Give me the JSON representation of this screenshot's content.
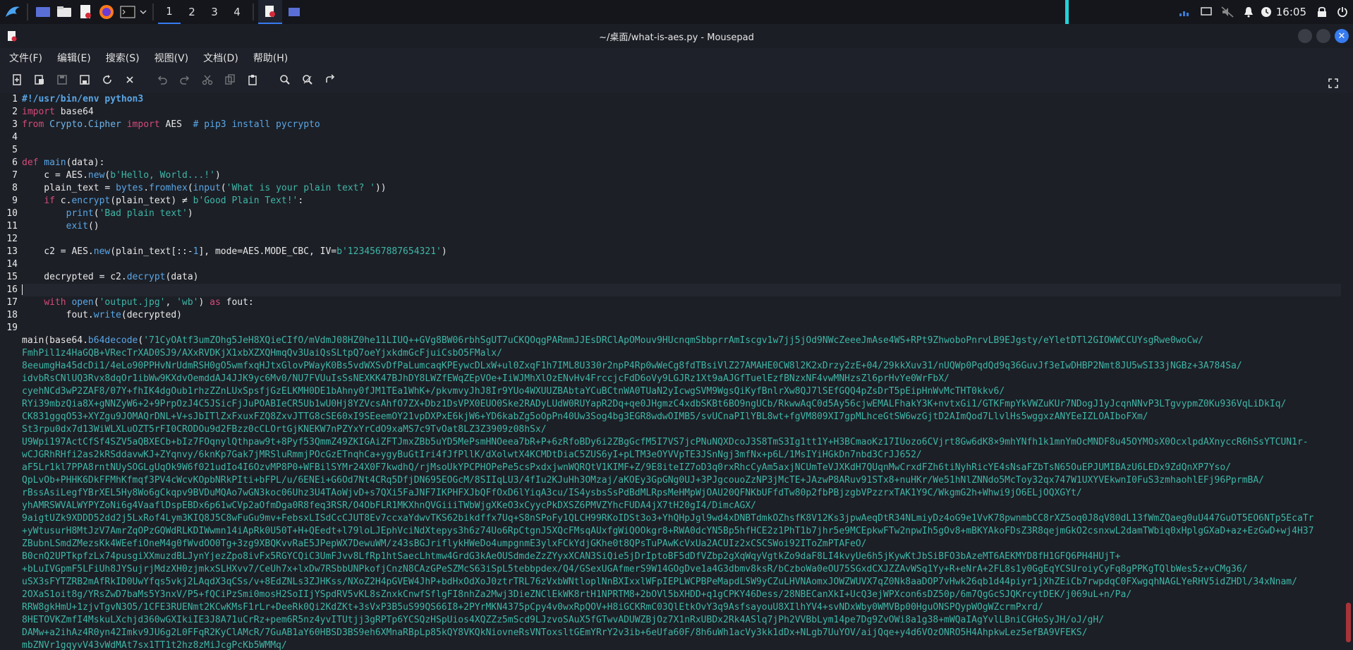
{
  "taskbar": {
    "workspaces": [
      "1",
      "2",
      "3",
      "4"
    ],
    "active_workspace": 0,
    "clock": "16:05",
    "icons": {
      "launcher": "kali-dragon-icon",
      "desktop": "show-desktop-icon",
      "files": "file-manager-icon",
      "editor": "text-editor-icon",
      "browser": "firefox-icon",
      "terminal": "terminal-icon"
    }
  },
  "window": {
    "title": "~/桌面/what-is-aes.py - Mousepad"
  },
  "menu": [
    "文件(F)",
    "编辑(E)",
    "搜索(S)",
    "视图(V)",
    "文档(D)",
    "帮助(H)"
  ],
  "editor": {
    "line_numbers": [
      "1",
      "2",
      "3",
      "4",
      "5",
      "6",
      "7",
      "8",
      "9",
      "10",
      "11",
      "12",
      "13",
      "14",
      "15",
      "16",
      "17",
      "18",
      "19",
      "",
      "",
      "",
      "",
      "",
      "",
      "",
      "",
      "",
      "",
      "",
      "",
      "",
      "",
      "",
      "",
      "",
      "",
      "",
      "",
      "",
      "",
      "",
      "",
      "",
      "",
      ""
    ],
    "code": {
      "l1": "#!/usr/bin/env python3",
      "l2_kw": "import",
      "l2_rest": " base64",
      "l3_kw1": "from",
      "l3_mod": " Crypto.Cipher",
      "l3_kw2": " import",
      "l3_rest": " AES  ",
      "l3_comment": "# pip3 install pycrypto",
      "l6_kw": "def",
      "l6_fn": " main",
      "l6_rest": "(data):",
      "l7_a": "    c = AES.",
      "l7_fn": "new",
      "l7_b": "(",
      "l7_str": "b'Hello, World...!'",
      "l7_c": ")",
      "l8_a": "    plain_text = ",
      "l8_fn1": "bytes",
      "l8_b": ".",
      "l8_fn2": "fromhex",
      "l8_c": "(",
      "l8_fn3": "input",
      "l8_d": "(",
      "l8_str": "'What is your plain text? '",
      "l8_e": "))",
      "l9_a": "    ",
      "l9_kw": "if",
      "l9_b": " c.",
      "l9_fn": "encrypt",
      "l9_c": "(plain_text) ≠ ",
      "l9_str": "b'Good Plain Text!'",
      "l9_d": ":",
      "l10_a": "        ",
      "l10_fn": "print",
      "l10_b": "(",
      "l10_str": "'Bad plain text'",
      "l10_c": ")",
      "l11_a": "        ",
      "l11_fn": "exit",
      "l11_b": "()",
      "l13_a": "    c2 = AES.",
      "l13_fn": "new",
      "l13_b": "(plain_text[::-",
      "l13_num": "1",
      "l13_c": "], mode=AES.MODE_CBC, IV=",
      "l13_str": "b'1234567887654321'",
      "l13_d": ")",
      "l15_a": "    decrypted = c2.",
      "l15_fn": "decrypt",
      "l15_b": "(data)",
      "l17_a": "    ",
      "l17_kw1": "with",
      "l17_b": " ",
      "l17_fn": "open",
      "l17_c": "(",
      "l17_str1": "'output.jpg'",
      "l17_d": ", ",
      "l17_str2": "'wb'",
      "l17_e": ") ",
      "l17_kw2": "as",
      "l17_f": " fout:",
      "l18_a": "        fout.",
      "l18_fn": "write",
      "l18_b": "(decrypted)",
      "l20_a": "main(base64.",
      "l20_fn": "b64decode",
      "l20_b": "("
    },
    "b64_first": "'71CyOAtf3umZOhg5JeH8XQieCIfO/mVdmJ08HZ0he11LIUQ++GVg8BW06rbhSgUT7uCKQOqgPARmmJJEsDRClApOMouv9HUcnqmSbbprrAmIscgv1w7jj5jOd9NWcZeeeJmAse4WS+RPt9ZhwoboPnrvLB9EJgsty/eYletDTl2GIOWWCCUYsgRwe0woCw/",
    "b64_lines": [
      "FmhPil1z4HaGQB+VRecTrXAD0SJ9/AXxRVDKjX1xbXZXQHmqQv3UaiQsSLtpQ7oeYjxkdmGcFjuiCsbO5FMalx/",
      "8eeumgHa45dcDi1/4eLo90PPHvNrUdmRSH0gO5wmfxqHJtxGlovPWayK0Bs5vdWXSvDfPaLumcaqKPEywcDLxW+ul0ZxqF1h7IML8U330r2npP4Rp0wWeCg8fdTBsiVlZ27AMAHE0CW8l2K2xDrzy2zE+04/29kkXuv31/nUQWp0PqdQd9q36GuvJf3eIwDHBP2Nmt8JU5wSI33jNGBz+3A784Sa/",
      "idvbRsCNlUQ3Rvx8dqOr1ibWw9KXdvOemddAJ4JJK9yc6Mv0/NU7FVUuIsSsNEXKK47BJhDY8LWZfEWqZEpVOe+IiWJMhXlOzENvHv4FrccjcFdD6oVy9LGJRz1Xt9aAJGfTuelEzfBNzxNF4vwMNHzsZl6prHvYe0WrFbX/",
      "cyehNCd3wP2ZAF8/07Y+fhIK4dgOub1rhzZZnLUxSpsfjGzELKMH0DE1bAhny0fJM1TEa1WhK+/pkvmvyJhJ8Ir9YUo4WXUUZBAbtaYCuBCtnWA0TUaN2yIcwgSVM9WgsQiKyfBnlrXw8QJ7lSEfGQQ4pZsDrT5pEipHnWvMcTHT0kkv6/",
      "RYi39mbzQia8X+gNNZyW6+2+9PrpOzJ4C5JSicFjJuPOABIeCR5Ub1wU0Hj8YZVcsAhfO7ZX+Dbz1DsVPX0EUO0Ske2RADyLUdW0RUYapR2Dq+qe0JHgmzC4xdbSKBt6BO9ngUCb/RkwwAqC0d5Ay56cjwEMALFhakY3K+nvtxGi1/GTKFmpYkVWZuKUr7NDogJ1yJcqnNNvP3LTgvypmZ0Ku936VqLiDkIq/",
      "CK831ggqO53+XYZgu9JOMAQrDNL+V+sJbITlZxFxuxFZQ8ZxvJTTG8cSE60xI9SEeemOY21vpDXPxE6kjW6+YD6kabZg5oOpPn40Uw3Sog4bg3EGR8wdwOIMB5/svUCnaPIlYBL8wt+fgVM809XI7gpMLhceGtSW6wzGjtD2AImQod7LlvlHs5wggxzANYEeIZLOAIboFXm/",
      "St3rpu0dx7d13WiWLXLuOZT5rFI0CRODOu9d2FBzz0cCLOrtGjKNEKW7nPZYxYrCdO9xaMS7c9TvOat8LZ3Z3909z08hSx/",
      "U9Wpi197ActCfSf4SZV5aQBXECb+bIz7FOqnylQthpaw9t+8Pyf53QmmZ49ZKIGAiZFTJmxZBb5uYD5MePsmHNOeea7bR+P+6zRfoBDy6i2ZBgGcfM5I7VS7jcPNuNQXDcoJ3S8TmS3Ig1tt1Y+H3BCmaoKz17IUozo6CVjrt8Gw6dK8×9mhYNfh1k1mnYmOcMNDF8u45OYMOsX0OcxlpdAXnyccR6hSsYTCUN1r-",
      "wCJGRhRHfi2as2kRSddavwKJ+ZYqnvy/6knKp7Gak7jMRSluRmmjPOcGzETnqhCa+ygyBuGtIri4fJfPllK/dXolwtX4KCMDtDiaC5ZUS6yI+pLTM3eOYVVpTE3JSnNgj3mfNx+p6L/1MsIYiHGkDn7nbd3CrJJ652/",
      "aF5Lr1kl7PPA8rntNUySOGLgUqOk9W6f021udIo4I6OzvMP8P0+WFBilSYMr24X0F7kwdhQ/rjMsoUkYPCPHOPePe5csPxdxjwnWQRQtV1KIMF+Z/9E8iteIZ7oD3q0rxRhcCyAm5axjNCUmTeVJXKdH7QUqnMwCrxdFZh6tiNyhRicYE4sNsaFZbTsN65OuEPJUMIBAzU6LEDx9ZdQnXP7Yso/",
      "QpLvOb+PHHK6DkFFMhKfmqf3PV4cWcvKOpbNRkPIti+bFPL/u/6ENEi+G6Od7Nt4CRq5DfjDN695EOGcM/8SIIqLU3/4fIu2KJuHh3OMzaj/aKOEy3GpGNg0UJ+3PJgcouoZzNP3jMcTE+JAzwP8ARuv91STx8+nuHKr/We51hNlZNNdo5McToy32qx747W1UXYVEkwnI0FuS3zmhaohlEFj96PprmBA/",
      "rBssAsiLegfYBrXEL5Hy8Wo6gCkqpv9BVDuMQAo7wGN3koc06Uhz3U4TAoWjvD+s7QXi5FaJNF7IKPHFXJbQFfOxD6lYiqA3cu/IS4ysbsSsPdBdMLRpsMeHMpWjOAU20QFNKbUFfdTw80p2fbPBjzgbVPzzrxTAK1Y9C/WkgmG2h+Whwi9jO6ELjOQXGYt/",
      "yhAMRSWVALWYPYZoNi6g4VaaflDspEBDx6p61wCVp2aOfmDga0R8feq3RSR/O4ObFLR1MKXhnQVGiiiTWbWjgXKeO3xCyycPkDXSZ6PMVZYhcFUDA4jX7tH20gI4/DimcAGX/",
      "9aigtUZk9XDDD52dd2j5LxRof4Lym3KIQ8J5C8wFuGu9mv+FebsxLISdCcCJUT8Ev7ccxaYdwvTKS62bikdffx7Uq+S8nSPoFy1QLCH99RKoIDSt3o3+YhQHpJgl9wd4xDNBTdmkOZhsfK8V12Ks3jpwAeqDtR34NLmiyDz4oG9e1VvK78pwnmbCC8rXZ5oq0J8qV80dL13fWmZQaeg0uU447GuOT5EO6NTp5EcaTr",
      "+yWtusurH8MtJzV7AmrZqOPzGQWdRLKDIWwmn14iApRk0U50T+H+QEedt+l79loLJEphVciNdXtepys3h6z74Uo6RpCtgnJ5XQcFMsqAUxfgWiQOOkgr8+RWA0dcYN5Bp5hfHCE2z1PhT1b7jhr5e9MCEpkwFTw2npwIh5gOv8+mBKYAkoFDsZ3R8qejmGkO2csnxwL2damTWbiq0xHplgGXaD+az+EzGwD+wj4H37",
      "ZBubnLSmdZMezsKk4WEefiOneM4g0fWvdOO0Tg+3zg9XBQKvvRaE5JPepWX7DewuWM/z43sBGJriflykHWeDo4umpgnmE3ylxFCkYdjGKhe0t8QPsTuPAwKcVxUa2ACUIz2xCSCSWoi92IToZmPTAFeO/",
      "B0cnQ2UPTkpfzLx74pusgiXXmuzdBLJynYjezZpo8ivFx5RGYCQiC3UmFJvv8LfRp1htSaecLhtmw4GrdG3kAeOUSdmdeZzZYyxXCAN3SiQie5jDrIptoBF5dDfVZbp2gXqWqyVgtkZo9daF8LI4kvyUe6h5jKywKtJbSiBFO3bAzeMT6AEKMYD8fH1GFQ6PH4HUjT+",
      "+bLuIVGpmF5LFiUh8JYSujrjMdzXH0zjmkxSLHXvv7/CeUh7x+lxDw7RSbbUNPkofjCnzN8CAzGPeSZMcS63iSpL5tebbpdex/Q4/GSexUGAfmerS9W14GOgDve1a4G3dbmv8ksR/bCzboWa0eOU75SGxdCXJZZAvWSq1Yy+R+eNrA+2FL8s1y0GgEqYCSUroiyCyFq8gPPKgTQlbWes5z+vCMg36/",
      "uSX3sFYTZRB2mAfRkID0UwYfqs5vkj2LAqdX3qCSs/v+8EdZNLs3ZJHKss/NXoZ2H4pGVEW4JhP+bdHxOdXoJ0ztrTRL76zVxbWNtloplNnBXIxxlWFpIEPLWCPBPeMapdLSW9yCZuLHVNAomxJOWZWUVX7qZ0Nk8aaDOP7vHwk26qb1d44piyr1jXhZEiCb7rwpdqC0FXwgqhNAGLYeRHV5idZHDl/34xNnam/",
      "2OXaS1oit8g/YRsZwD7baMs5Y3nxV/P5+fQCiPzSmi0mosH2SoIIjYSpdRV5vKL8sZnxkCnwfSflgFI8nhZa2Mwj3DieZNClEkWK8rtH1NPRTM8+2bOVl5bXHDD+q1gCPKY46Dess/28NBECanXkI+UcQ3ejWPXcon6sDZ50p/6m7QgGcSJQKrcytDEK/j069uL+n/Pa/",
      "RRW8gkHmU+1zjvTgvN3O5/1CFE3RUENmt2KCwKMsF1rLr+DeeRk0Qi2KdZKt+3sVxP3B5uS99QS66I8+2PYrMKN4375pCpy4v0wxRpQOV+H8iGCKRmC03QlEtkOvY3q9AsfsayouU8XIlhYV4+svNDxWby0WMVBp00HguONSPQypWOgWZcrmPxrd/",
      "8HETOVKZmfI4MskuLXchjd360wGXIkiIE3J8A71uCrRz+pem6R5nz4yvITUtjj3gRPTp6YCSQzHSpUios4XQZZz5mScd9LJzvoSAuX5fGTwvADUWZBjOz7X1nRxUBDx2Rk4ASlq7jPh2VVBbLym14pe7Dg9ZvOWi8a1g38+mWQaIAgYvlLBniCGHoSyJH/oJ/gH/",
      "DAMw+a2ihAz4R0yn42Imkv9JU6g2L0FFqR2KyClAMcR/7GuAB1aY60HBSD3BS9eh6XMnaRBpLp85kQY8VKQkNiovneRsVNToxsltGEmYRrY2v3ib+6eUfa60F/8h6uWh1acVy3kk1dDx+NLgb7UuYOV/aijQqe+y4d6VOzONRO5H4AhpkwLez5efBA9VFEKS/",
      "mbZNVr1gqyvV43vWdMAt7sx1TT1t2hz8zMiJcgPcKb5WMMq/"
    ]
  }
}
